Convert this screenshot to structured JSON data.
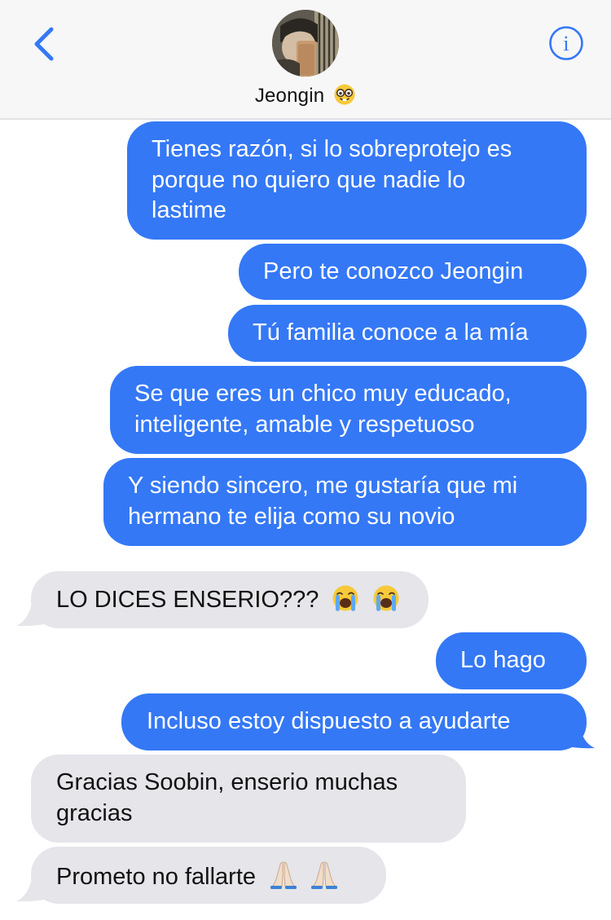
{
  "header": {
    "contact_name": "Jeongin",
    "contact_emoji_icon": "nerd-face-icon",
    "back_icon": "chevron-left-icon",
    "info_icon": "info-icon",
    "accent_color": "#3478f6"
  },
  "messages": [
    {
      "from": "me",
      "text": "Tienes razón, si lo sobreprotejo es porque no quiero que nadie lo lastime",
      "lines": [
        "Tienes razón, si lo sobreprotejo es",
        "porque no quiero que nadie lo",
        "lastime"
      ]
    },
    {
      "from": "me",
      "text": "Pero te conozco Jeongin"
    },
    {
      "from": "me",
      "text": "Tú familia conoce a la mía"
    },
    {
      "from": "me",
      "text": "Se que eres un chico muy educado, inteligente, amable y respetuoso",
      "lines": [
        "Se que eres un chico muy educado,",
        "inteligente, amable y respetuoso"
      ]
    },
    {
      "from": "me",
      "text": "Y siendo sincero, me gustaría que mi hermano te elija como su novio",
      "lines": [
        "Y siendo sincero, me gustaría que mi",
        "hermano te elija como su novio"
      ]
    },
    {
      "from": "them",
      "text": "LO DICES ENSERIO???",
      "emojis": [
        "loudly-crying-face-icon",
        "loudly-crying-face-icon"
      ]
    },
    {
      "from": "me",
      "text": "Lo hago"
    },
    {
      "from": "me",
      "text": "Incluso estoy dispuesto a ayudarte"
    },
    {
      "from": "them",
      "text": "Gracias Soobin, enserio muchas gracias",
      "lines": [
        "Gracias Soobin, enserio muchas",
        "gracias"
      ]
    },
    {
      "from": "them",
      "text": "Prometo no fallarte",
      "emojis": [
        "folded-hands-icon",
        "folded-hands-icon"
      ]
    }
  ],
  "colors": {
    "sent_bubble": "#3478f6",
    "received_bubble": "#e5e5ea",
    "header_bg": "#f7f7f7"
  }
}
